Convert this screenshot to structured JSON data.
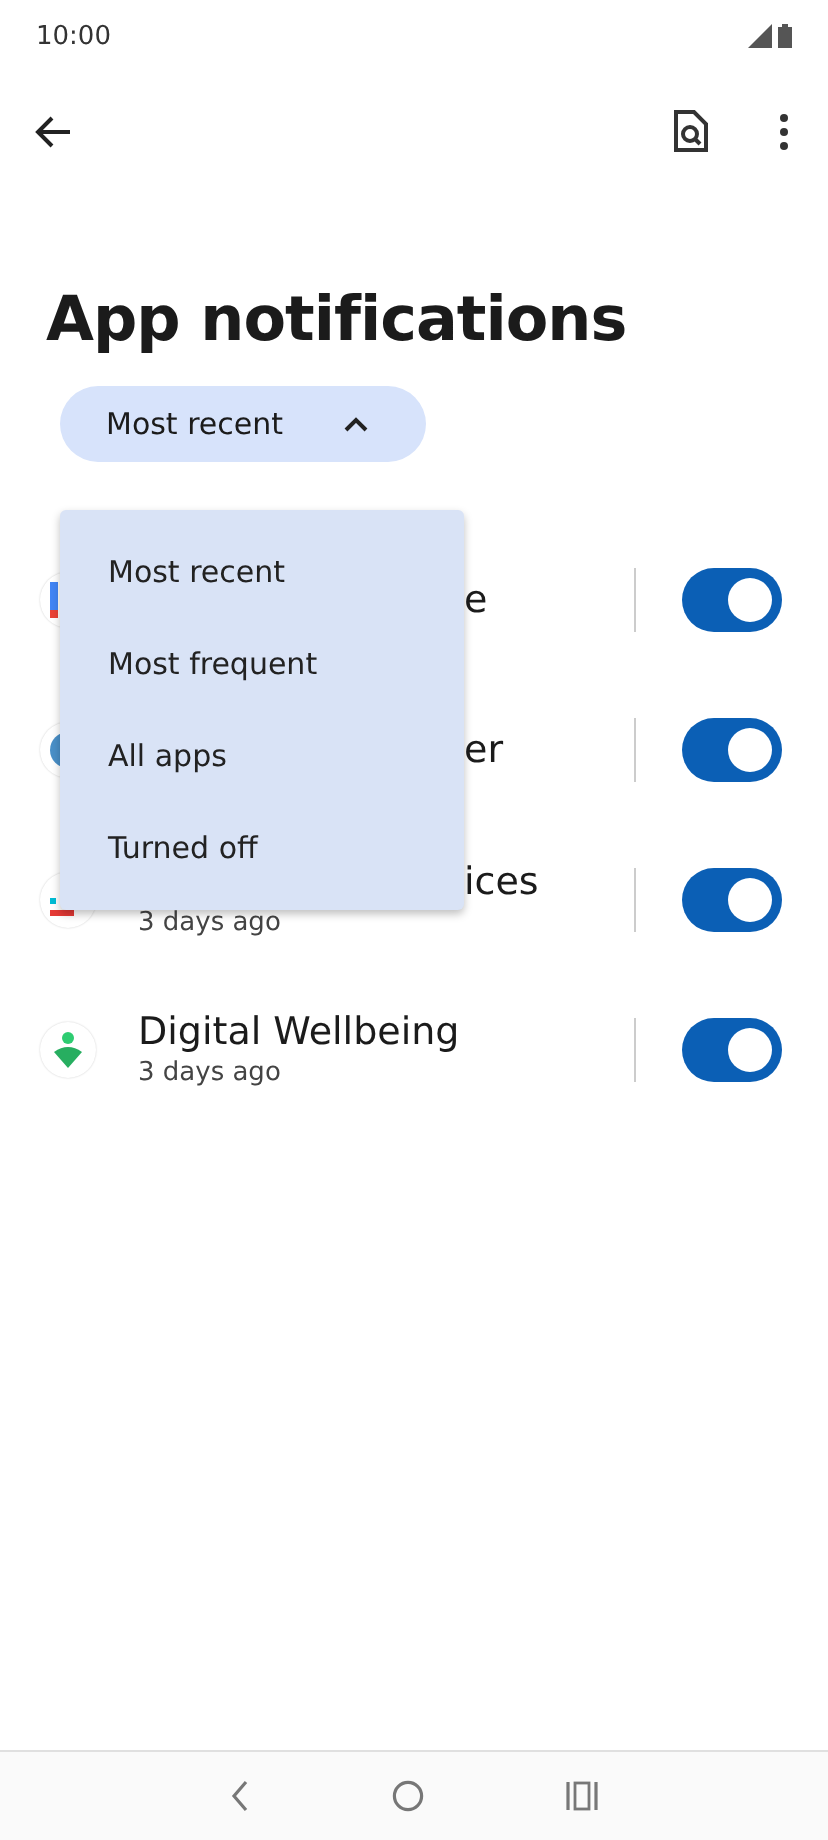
{
  "status_bar": {
    "time": "10:00"
  },
  "title": "App notifications",
  "sort_chip": {
    "label": "Most recent",
    "expanded": true
  },
  "apps": [
    {
      "name": "e",
      "covered": true,
      "on": true
    },
    {
      "name": "er",
      "covered": true,
      "on": true
    },
    {
      "name": "ices",
      "covered": true,
      "subtitle": "3 days ago",
      "on": true
    },
    {
      "name": "Digital Wellbeing",
      "covered": false,
      "subtitle": "3 days ago",
      "on": true
    }
  ],
  "menu": {
    "items": [
      "Most recent",
      "Most frequent",
      "All apps",
      "Turned off"
    ]
  }
}
